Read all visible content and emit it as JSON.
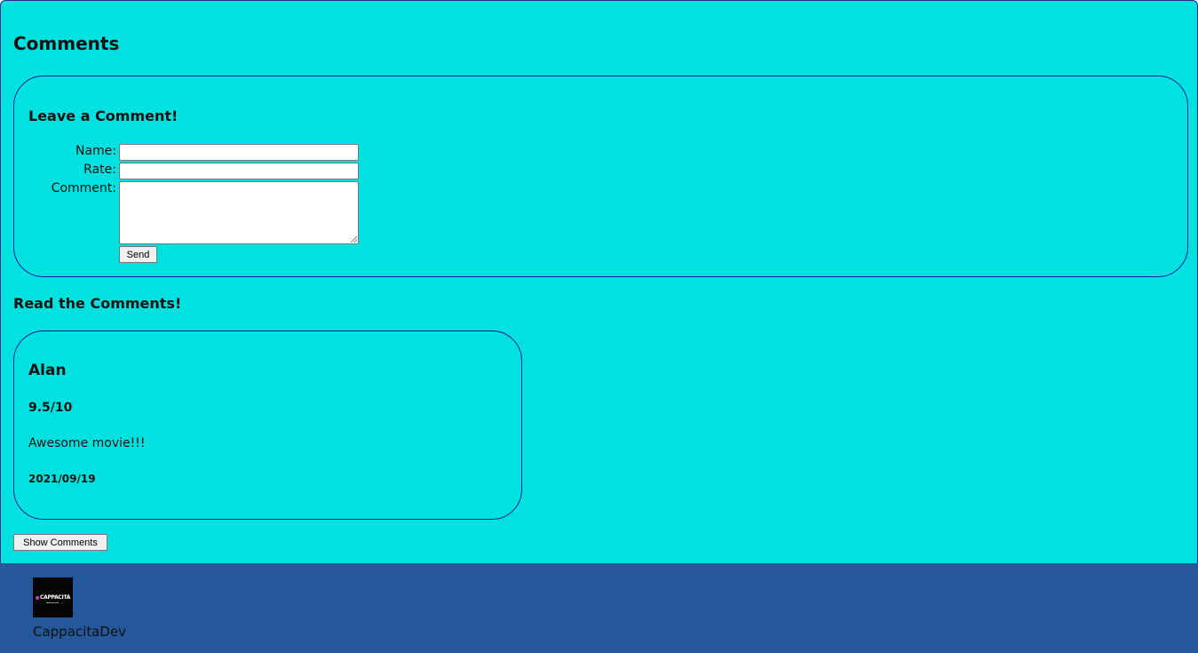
{
  "page": {
    "title": "Comments"
  },
  "form": {
    "heading": "Leave a Comment!",
    "name_label": "Name:",
    "name_value": "",
    "rate_label": "Rate:",
    "rate_value": "",
    "comment_label": "Comment:",
    "comment_value": "",
    "send_label": "Send"
  },
  "comments_section": {
    "heading": "Read the Comments!",
    "items": [
      {
        "author": "Alan",
        "rate": "9.5/10",
        "text": "Awesome movie!!!",
        "date": "2021/09/19"
      }
    ],
    "show_button_label": "Show Comments"
  },
  "footer": {
    "logo_text": "CAPPACITA",
    "brand": "CappacitaDev"
  },
  "colors": {
    "main_bg": "#00e1e0",
    "footer_bg": "#24589a",
    "border": "#1a1a9a",
    "logo_accent": "#d22bd6"
  },
  "icons": {
    "logo": "cappacita-logo-icon",
    "textarea_resize": "resize-handle-icon"
  }
}
